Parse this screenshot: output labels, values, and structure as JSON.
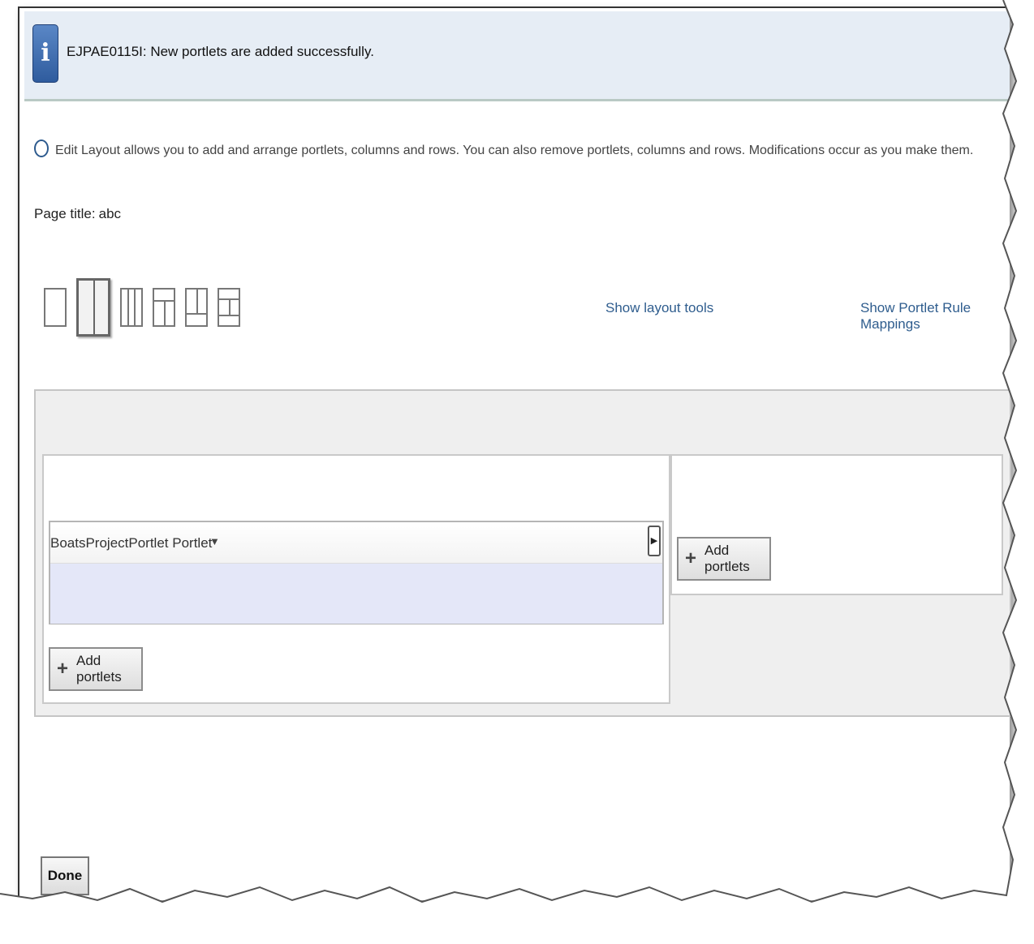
{
  "message": {
    "icon": "info-icon",
    "text": "EJPAE0115I: New portlets are added successfully."
  },
  "help": {
    "icon": "help-bubble-icon",
    "text": "Edit Layout allows you to add and arrange portlets, columns and rows. You can also remove portlets, columns and rows. Modifications occur as you make them."
  },
  "page_title": {
    "label": "Page title:",
    "value": "abc"
  },
  "layout_options": [
    "one-column-layout-icon",
    "two-column-layout-icon",
    "three-column-layout-icon",
    "header-two-column-layout-icon",
    "two-column-footer-layout-icon",
    "header-footer-layout-icon"
  ],
  "links": {
    "layout_tools": "Show layout tools",
    "rule_mappings": "Show Portlet Rule Mappings"
  },
  "portlet": {
    "title": "BoatsProjectPortlet Portlet",
    "menu_icon": "dropdown-triangle-icon",
    "move_icon": "arrow-right-icon"
  },
  "buttons": {
    "add_portlets_left": "Add portlets",
    "add_portlets_right": "Add portlets",
    "done": "Done"
  }
}
